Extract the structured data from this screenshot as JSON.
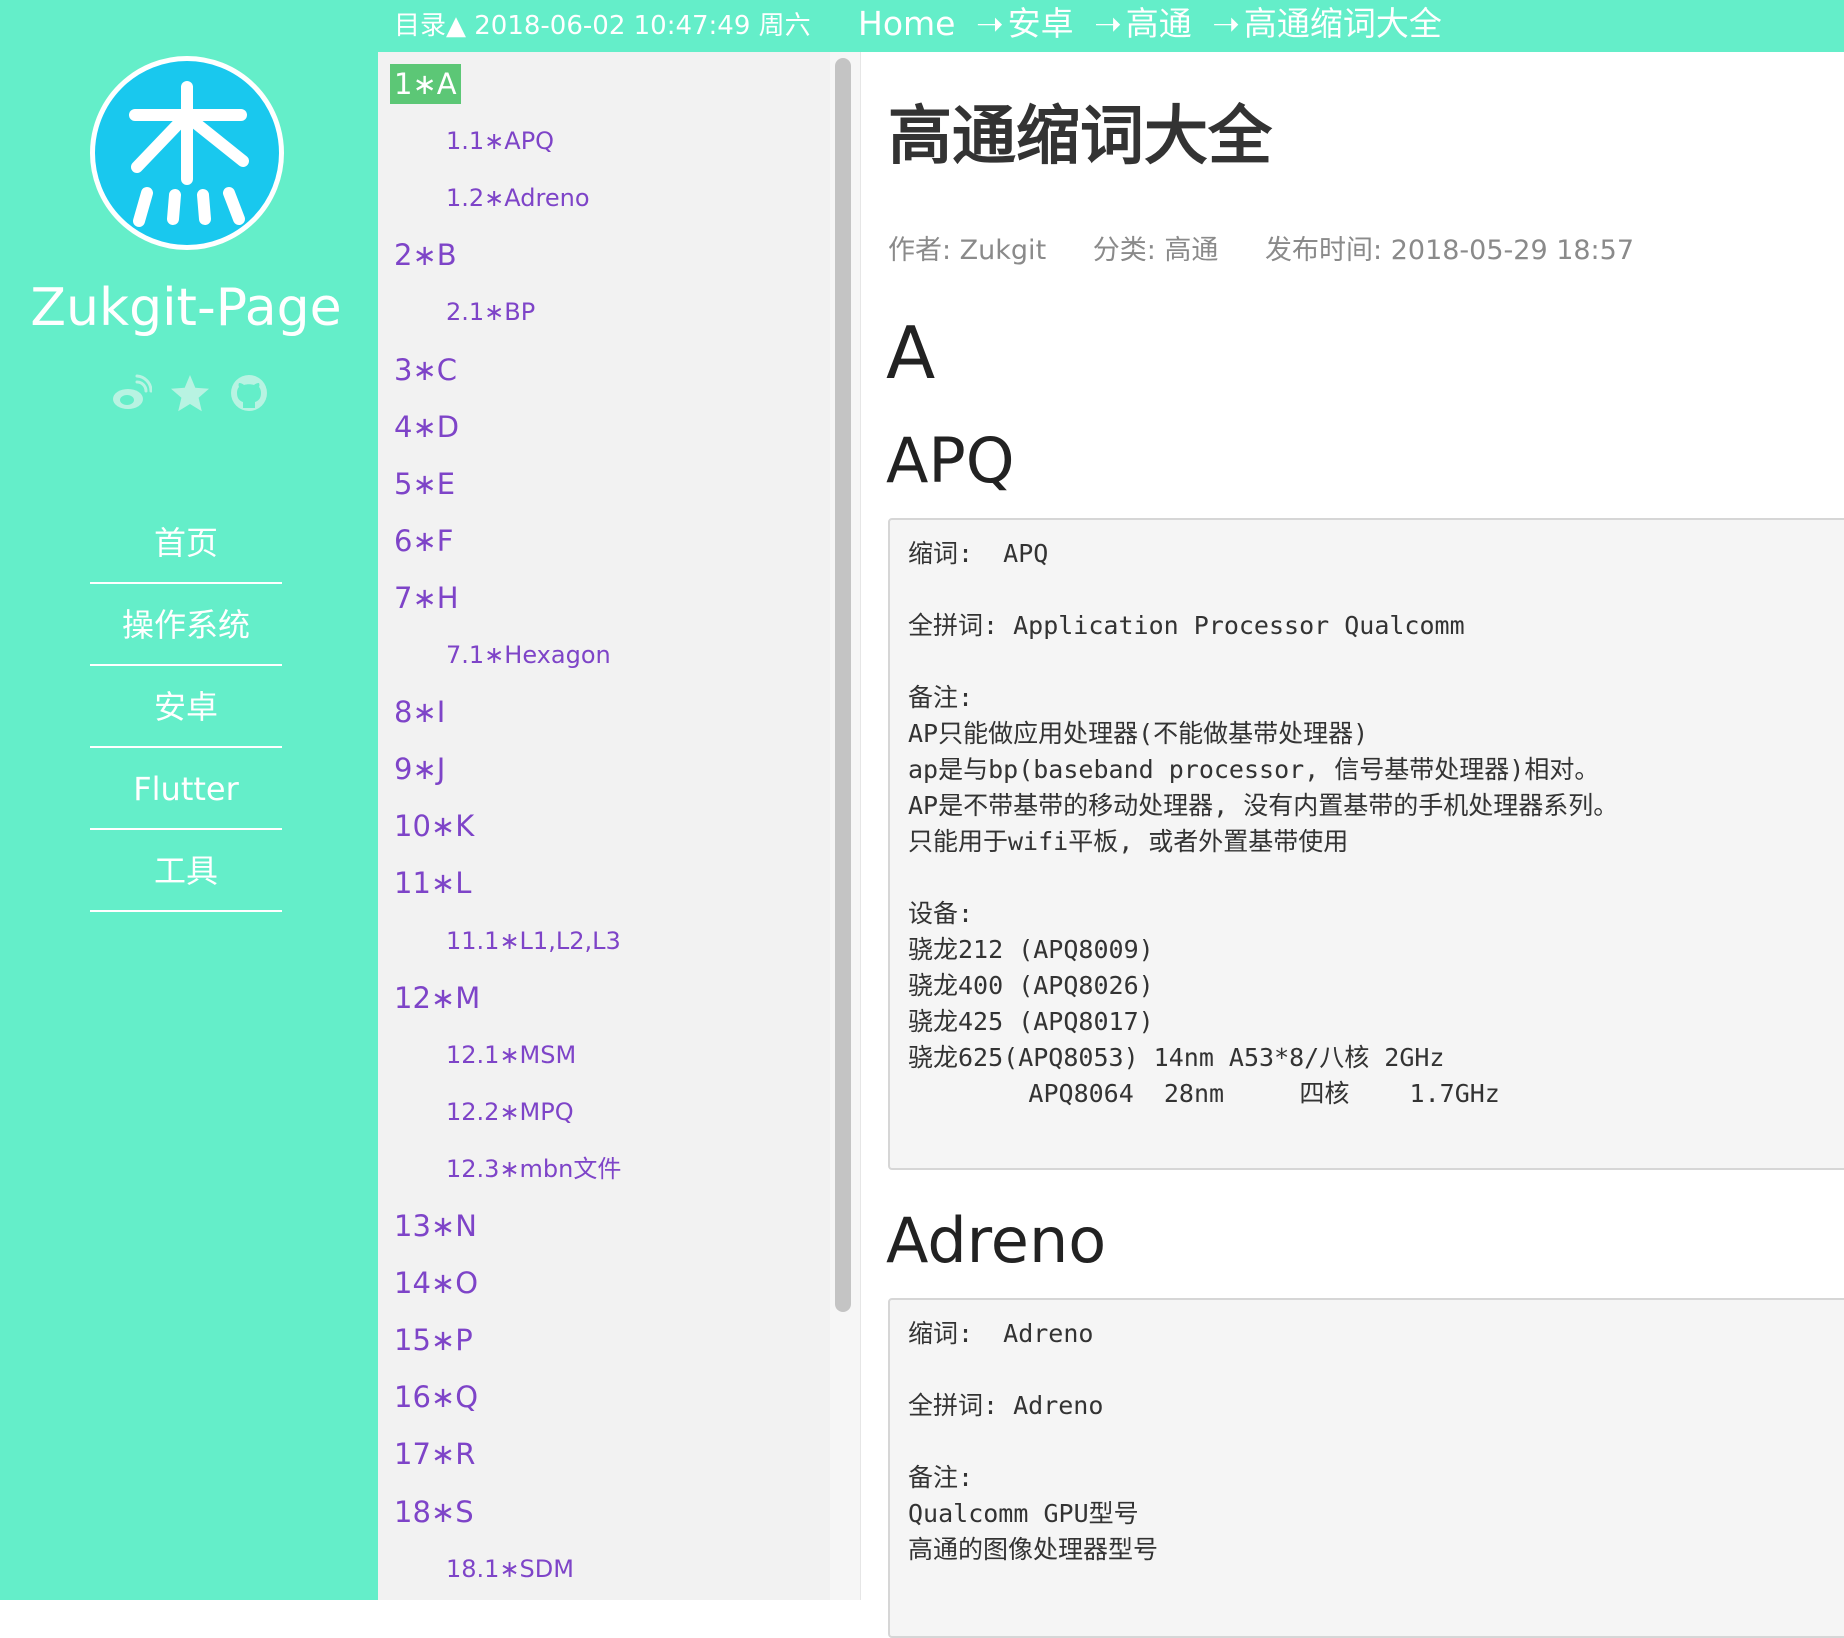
{
  "topbar": {
    "toc_status": "目录▲ 2018-06-02 10:47:49 周六",
    "breadcrumb": [
      "Home",
      "安卓",
      "高通",
      "高通缩词大全"
    ],
    "separator": "➝"
  },
  "sidebar": {
    "site_title": "Zukgit-Page",
    "avatar_char": "杰",
    "social_icons": [
      "weibo-icon",
      "star-icon",
      "github-icon"
    ],
    "nav": [
      "首页",
      "操作系统",
      "安卓",
      "Flutter",
      "工具"
    ]
  },
  "toc": {
    "items": [
      {
        "label": "1∗A",
        "level": 1
      },
      {
        "label": "1.1∗APQ",
        "level": 2
      },
      {
        "label": "1.2∗Adreno",
        "level": 2
      },
      {
        "label": "2∗B",
        "level": 1
      },
      {
        "label": "2.1∗BP",
        "level": 2
      },
      {
        "label": "3∗C",
        "level": 1
      },
      {
        "label": "4∗D",
        "level": 1
      },
      {
        "label": "5∗E",
        "level": 1
      },
      {
        "label": "6∗F",
        "level": 1
      },
      {
        "label": "7∗H",
        "level": 1
      },
      {
        "label": "7.1∗Hexagon",
        "level": 2
      },
      {
        "label": "8∗I",
        "level": 1
      },
      {
        "label": "9∗J",
        "level": 1
      },
      {
        "label": "10∗K",
        "level": 1
      },
      {
        "label": "11∗L",
        "level": 1
      },
      {
        "label": "11.1∗L1,L2,L3",
        "level": 2
      },
      {
        "label": "12∗M",
        "level": 1
      },
      {
        "label": "12.1∗MSM",
        "level": 2
      },
      {
        "label": "12.2∗MPQ",
        "level": 2
      },
      {
        "label": "12.3∗mbn文件",
        "level": 2
      },
      {
        "label": "13∗N",
        "level": 1
      },
      {
        "label": "14∗O",
        "level": 1
      },
      {
        "label": "15∗P",
        "level": 1
      },
      {
        "label": "16∗Q",
        "level": 1
      },
      {
        "label": "17∗R",
        "level": 1
      },
      {
        "label": "18∗S",
        "level": 1
      },
      {
        "label": "18.1∗SDM",
        "level": 2
      }
    ]
  },
  "article": {
    "title": "高通缩词大全",
    "meta": {
      "author": "作者: Zukgit",
      "category": "分类: 高通",
      "published": "发布时间: 2018-05-29 18:57"
    },
    "section_a": "A",
    "sub_apq": "APQ",
    "apq_lines": [
      "缩词:  APQ",
      "",
      "全拼词: Application Processor Qualcomm",
      "",
      "备注:",
      "AP只能做应用处理器(不能做基带处理器)",
      "ap是与bp(baseband processor, 信号基带处理器)相对。",
      "AP是不带基带的移动处理器, 没有内置基带的手机处理器系列。",
      "只能用于wifi平板, 或者外置基带使用",
      "",
      "设备:",
      "骁龙212 (APQ8009)",
      "骁龙400 (APQ8026)",
      "骁龙425 (APQ8017)",
      "骁龙625(APQ8053) 14nm A53*8/八核 2GHz",
      "        APQ8064  28nm     四核    1.7GHz"
    ],
    "sub_adreno": "Adreno",
    "adreno_lines": [
      "缩词:  Adreno",
      "",
      "全拼词: Adreno",
      "",
      "备注:",
      "Qualcomm GPU型号",
      "高通的图像处理器型号"
    ]
  }
}
